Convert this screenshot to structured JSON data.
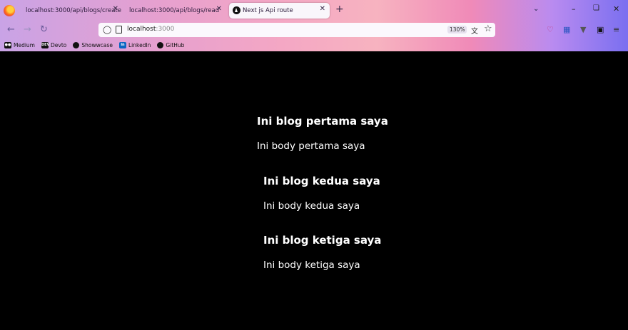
{
  "browser": {
    "tabs": [
      {
        "title": "localhost:3000/api/blogs/create",
        "active": false
      },
      {
        "title": "localhost:3000/api/blogs/read",
        "active": false
      },
      {
        "title": "Next js Api route",
        "active": true
      }
    ],
    "close_glyph": "✕",
    "new_tab_glyph": "+",
    "url": {
      "host": "localhost",
      "port": ":3000"
    },
    "zoom": "130%",
    "bookmarks": [
      {
        "label": "Medium",
        "icon": "medium-icon"
      },
      {
        "label": "Devto",
        "icon": "devto-icon"
      },
      {
        "label": "Showwcase",
        "icon": "showwcase-icon"
      },
      {
        "label": "LinkedIn",
        "icon": "linkedin-icon"
      },
      {
        "label": "GitHub",
        "icon": "github-icon"
      }
    ],
    "bookmark_icon_text": {
      "devto": "DEV",
      "linkedin": "in"
    }
  },
  "posts": [
    {
      "title": "Ini blog pertama saya",
      "body": "Ini body pertama saya"
    },
    {
      "title": "Ini blog kedua saya",
      "body": "Ini body kedua saya"
    },
    {
      "title": "Ini blog ketiga saya",
      "body": "Ini body ketiga saya"
    }
  ],
  "colors": {
    "page_background": "#000000",
    "text": "#ffffff"
  }
}
